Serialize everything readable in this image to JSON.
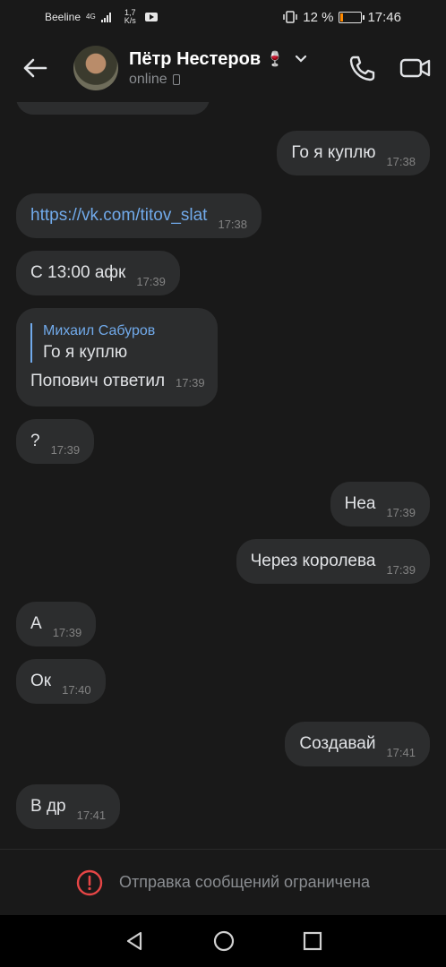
{
  "status_bar": {
    "carrier": "Beeline",
    "network": "4G",
    "speed_value": "1,7",
    "speed_unit": "K/s",
    "battery": "12 %",
    "battery_level": 0.12,
    "time": "17:46"
  },
  "header": {
    "contact_name": "Пётр Нестеров",
    "contact_emoji": "🍷",
    "status": "online"
  },
  "messages": [
    {
      "side": "out",
      "text": "Го я куплю",
      "time": "17:38"
    },
    {
      "side": "in",
      "text": "https://vk.com/titov_slat",
      "time": "17:38",
      "link": true
    },
    {
      "side": "in",
      "text": "С 13:00 афк",
      "time": "17:39"
    },
    {
      "side": "in",
      "reply_author": "Михаил Сабуров",
      "reply_text": "Го я куплю",
      "text": "Попович ответил",
      "time": "17:39"
    },
    {
      "side": "in",
      "text": "?",
      "time": "17:39"
    },
    {
      "side": "out",
      "text": "Неа",
      "time": "17:39"
    },
    {
      "side": "out",
      "text": "Через королева",
      "time": "17:39"
    },
    {
      "side": "in",
      "text": "А",
      "time": "17:39"
    },
    {
      "side": "in",
      "text": "Ок",
      "time": "17:40"
    },
    {
      "side": "out",
      "text": "Создавай",
      "time": "17:41"
    },
    {
      "side": "in",
      "text": "В др",
      "time": "17:41"
    }
  ],
  "restriction": {
    "text": "Отправка сообщений ограничена",
    "icon": "alert-circle-icon",
    "icon_color": "#e64646"
  },
  "colors": {
    "background": "#191919",
    "bubble": "#2c2d2e",
    "link": "#71aaeb",
    "timestamp": "#828282"
  }
}
